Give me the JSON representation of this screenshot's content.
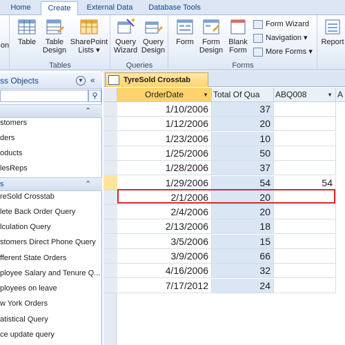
{
  "ribbon_tabs": [
    "Home",
    "Create",
    "External Data",
    "Database Tools"
  ],
  "ribbon": {
    "partial_left_label": "on",
    "tables_group": {
      "title": "Tables",
      "buttons": [
        "Table",
        "Table\nDesign",
        "SharePoint\nLists ▾"
      ]
    },
    "queries_group": {
      "title": "Queries",
      "buttons": [
        "Query\nWizard",
        "Query\nDesign"
      ]
    },
    "forms_group": {
      "title": "Forms",
      "buttons": [
        "Form",
        "Form\nDesign",
        "Blank\nForm"
      ],
      "small": [
        "Form Wizard",
        "Navigation ▾",
        "More Forms ▾"
      ]
    },
    "report_label": "Report"
  },
  "nav": {
    "title": "ss Objects",
    "sections": [
      {
        "label": "",
        "items": [
          "stomers",
          "ders",
          "oducts",
          "lesReps"
        ]
      },
      {
        "label": "s",
        "items": [
          "reSold Crosstab",
          "lete Back Order Query",
          "lculation Query",
          "stomers Direct Phone Query",
          "fferent State Orders",
          "ployee Salary and Tenure Q...",
          "ployees on leave",
          "w York Orders",
          "atistical Query",
          "ce update query"
        ]
      }
    ]
  },
  "document": {
    "tab_label": "TyreSold Crosstab",
    "columns": [
      "OrderDate",
      "Total Of Qua",
      "ABQ008",
      "A"
    ],
    "rows": [
      [
        "1/10/2006",
        "37",
        ""
      ],
      [
        "1/12/2006",
        "20",
        ""
      ],
      [
        "1/23/2006",
        "10",
        ""
      ],
      [
        "1/25/2006",
        "50",
        ""
      ],
      [
        "1/28/2006",
        "37",
        ""
      ],
      [
        "1/29/2006",
        "54",
        "54"
      ],
      [
        "2/1/2006",
        "20",
        ""
      ],
      [
        "2/4/2006",
        "20",
        ""
      ],
      [
        "2/13/2006",
        "18",
        ""
      ],
      [
        "3/5/2006",
        "15",
        ""
      ],
      [
        "3/9/2006",
        "66",
        ""
      ],
      [
        "4/16/2006",
        "32",
        ""
      ],
      [
        "7/17/2012",
        "24",
        ""
      ]
    ],
    "highlighted_row_index": 5
  }
}
